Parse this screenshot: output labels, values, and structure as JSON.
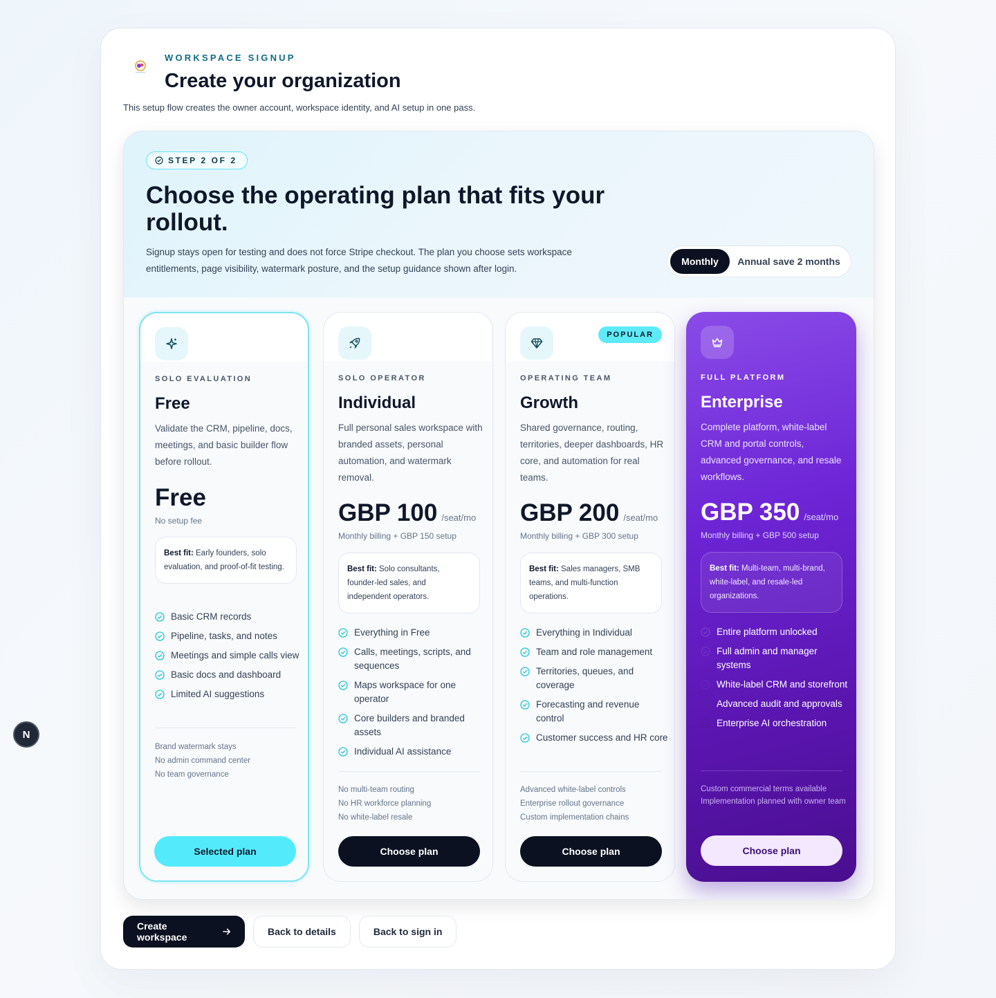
{
  "header": {
    "eyebrow": "WORKSPACE SIGNUP",
    "title": "Create your organization",
    "subtitle": "This setup flow creates the owner account, workspace identity, and AI setup in one pass."
  },
  "hero": {
    "step_label": "STEP 2 OF 2",
    "title": "Choose the operating plan that fits your rollout.",
    "description": "Signup stays open for testing and does not force Stripe checkout. The plan you choose sets workspace entitlements, page visibility, watermark posture, and the setup guidance shown after login.",
    "billing_toggle": {
      "monthly": "Monthly",
      "annual": "Annual save 2 months",
      "selected": "Monthly"
    }
  },
  "plans": [
    {
      "tier": "SOLO EVALUATION",
      "name": "Free",
      "description": "Validate the CRM, pipeline, docs, meetings, and basic builder flow before rollout.",
      "price": "Free",
      "per": "",
      "price_note": "No setup fee",
      "best_fit_label": "Best fit:",
      "best_fit": "Early founders, solo evaluation, and proof-of-fit testing.",
      "features": [
        "Basic CRM records",
        "Pipeline, tasks, and notes",
        "Meetings and simple calls view",
        "Basic docs and dashboard",
        "Limited AI suggestions"
      ],
      "limits": [
        "Brand watermark stays",
        "No admin command center",
        "No team governance"
      ],
      "cta": "Selected plan",
      "icon": "sparkles-icon",
      "selected": true
    },
    {
      "tier": "SOLO OPERATOR",
      "name": "Individual",
      "description": "Full personal sales workspace with branded assets, personal automation, and watermark removal.",
      "price": "GBP 100",
      "per": "/seat/mo",
      "price_note": "Monthly billing + GBP 150 setup",
      "best_fit_label": "Best fit:",
      "best_fit": "Solo consultants, founder-led sales, and independent operators.",
      "features": [
        "Everything in Free",
        "Calls, meetings, scripts, and sequences",
        "Maps workspace for one operator",
        "Core builders and branded assets",
        "Individual AI assistance"
      ],
      "limits": [
        "No multi-team routing",
        "No HR workforce planning",
        "No white-label resale"
      ],
      "cta": "Choose plan",
      "icon": "rocket-icon"
    },
    {
      "tier": "OPERATING TEAM",
      "name": "Growth",
      "badge": "POPULAR",
      "description": "Shared governance, routing, territories, deeper dashboards, HR core, and automation for real teams.",
      "price": "GBP 200",
      "per": "/seat/mo",
      "price_note": "Monthly billing + GBP 300 setup",
      "best_fit_label": "Best fit:",
      "best_fit": "Sales managers, SMB teams, and multi-function operations.",
      "features": [
        "Everything in Individual",
        "Team and role management",
        "Territories, queues, and coverage",
        "Forecasting and revenue control",
        "Customer success and HR core"
      ],
      "limits": [
        "Advanced white-label controls",
        "Enterprise rollout governance",
        "Custom implementation chains"
      ],
      "cta": "Choose plan",
      "icon": "diamond-icon"
    },
    {
      "tier": "FULL PLATFORM",
      "name": "Enterprise",
      "description": "Complete platform, white-label CRM and portal controls, advanced governance, and resale workflows.",
      "price": "GBP 350",
      "per": "/seat/mo",
      "price_note": "Monthly billing + GBP 500 setup",
      "best_fit_label": "Best fit:",
      "best_fit": "Multi-team, multi-brand, white-label, and resale-led organizations.",
      "features": [
        "Entire platform unlocked",
        "Full admin and manager systems",
        "White-label CRM and storefront",
        "Advanced audit and approvals",
        "Enterprise AI orchestration"
      ],
      "limits": [
        "Custom commercial terms available",
        "Implementation planned with owner team"
      ],
      "cta": "Choose plan",
      "icon": "crown-icon"
    }
  ],
  "actions": {
    "create": "Create workspace",
    "back_details": "Back to details",
    "back_signin": "Back to sign in"
  },
  "dev_badge": "N",
  "colors": {
    "accent_cyan": "#53ebfc",
    "enterprise_purple": "#6d25d6",
    "dark": "#0b1120"
  }
}
